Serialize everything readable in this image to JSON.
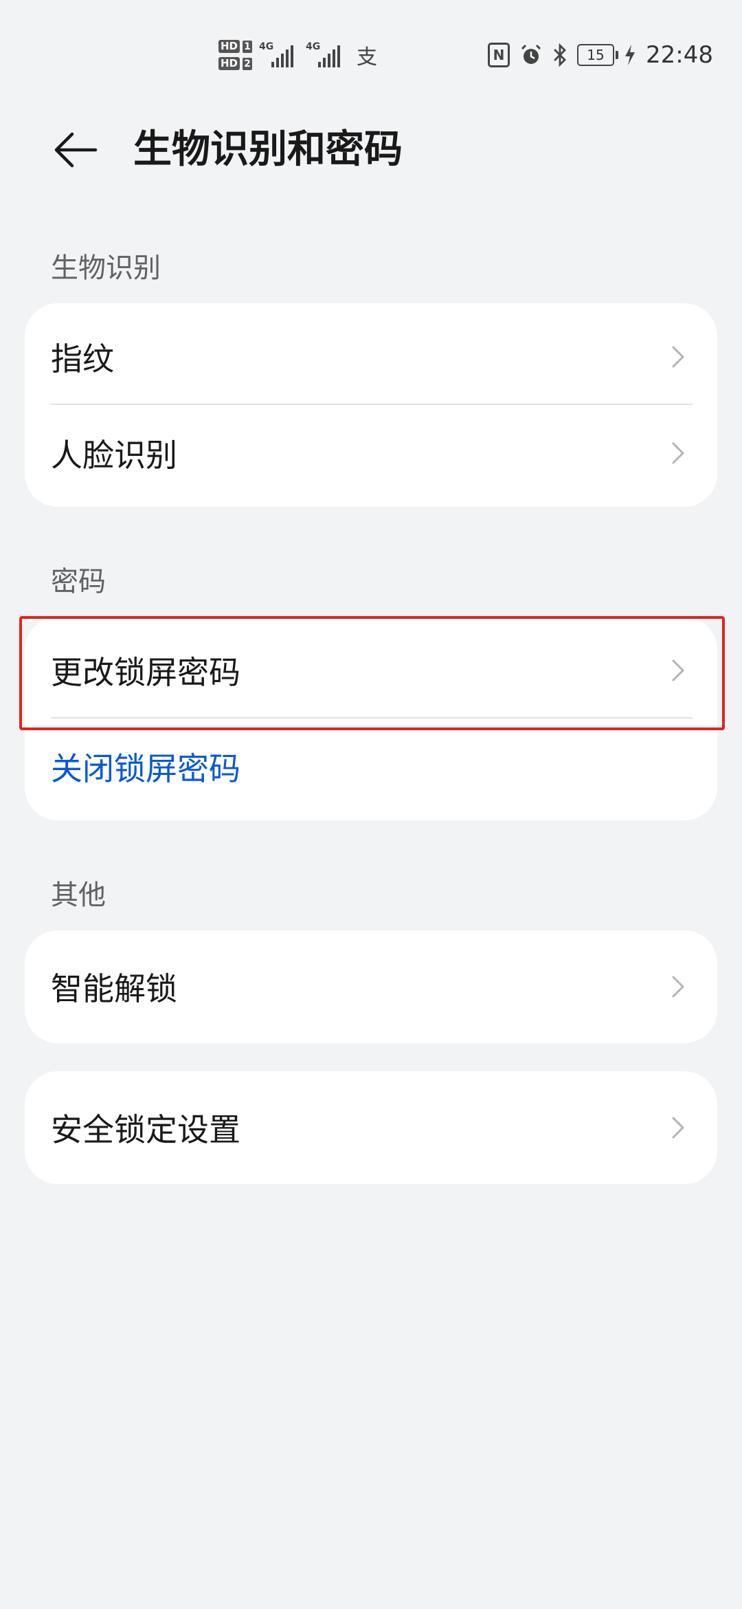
{
  "status_bar": {
    "hd_labels": [
      "HD",
      "HD"
    ],
    "hd_nums": [
      "1",
      "2"
    ],
    "network_1": "4G",
    "network_2": "4G",
    "pay_icon": "支",
    "battery_level": "15",
    "time": "22:48",
    "icons": [
      "nfc-icon",
      "alarm-icon",
      "bluetooth-icon",
      "charging-icon"
    ]
  },
  "header": {
    "title": "生物识别和密码",
    "back_icon": "arrow-left-icon"
  },
  "sections": {
    "biometrics": {
      "label": "生物识别",
      "items": [
        {
          "label": "指纹"
        },
        {
          "label": "人脸识别"
        }
      ]
    },
    "password": {
      "label": "密码",
      "items": [
        {
          "label": "更改锁屏密码"
        },
        {
          "label": "关闭锁屏密码"
        }
      ]
    },
    "other": {
      "label": "其他",
      "items": [
        {
          "label": "智能解锁"
        }
      ]
    },
    "security_lock": {
      "items": [
        {
          "label": "安全锁定设置"
        }
      ]
    }
  },
  "colors": {
    "background": "#f1f3f5",
    "card": "#ffffff",
    "link_blue": "#0a59d3",
    "highlight_red": "#e0241d"
  }
}
